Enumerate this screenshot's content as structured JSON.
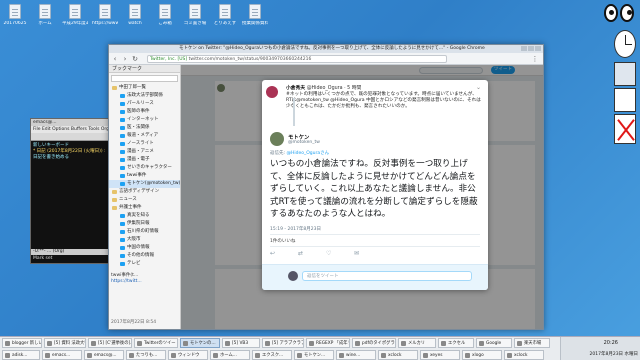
{
  "desktop": {
    "icons": [
      {
        "label": "20170625"
      },
      {
        "label": "ホーム"
      },
      {
        "label": "平成29年度あばば"
      },
      {
        "label": "https://www.yo..."
      },
      {
        "label": "watch"
      },
      {
        "label": "ごみ箱"
      },
      {
        "label": "ゴミ置き場"
      },
      {
        "label": "とりあえず"
      },
      {
        "label": "授業関係資料"
      }
    ]
  },
  "emacs": {
    "title": "emacs@...",
    "menu": "File Edit Options Buffers Tools Org Tbl",
    "line1": "新しいキーボード",
    "line2": "* 日記 (2017年8月22日 (火曜日)) :",
    "line3": "日記を書き始める",
    "modeline": "-U:**- ... (Org)",
    "echo": "Mark set"
  },
  "browser": {
    "title": "モトケン on Twitter: \"@Hideo_Oguraいつもの小倉論法ですね。反対事例を一つ取り上げて、全体に反論したように見せかけて…\" - Google Chrome",
    "url_secure": "Twitter, Inc. [US]",
    "url": "twitter.com/motoken_tw/status/900349703660244216",
    "sidebar_header": "ブックマーク",
    "bookmarks": [
      {
        "label": "中田了郎一覧",
        "folder": true
      },
      {
        "label": "法政大法学部関係",
        "folder": false
      },
      {
        "label": "パールリース",
        "folder": false
      },
      {
        "label": "医師の事件",
        "folder": false
      },
      {
        "label": "インターネット",
        "folder": false
      },
      {
        "label": "医・法関係",
        "folder": false
      },
      {
        "label": "報道・メディア",
        "folder": false
      },
      {
        "label": "ノースライト",
        "folder": false
      },
      {
        "label": "漫画・アニメ",
        "folder": false
      },
      {
        "label": "漫画・電子",
        "folder": false
      },
      {
        "label": "せいきのキャラクター",
        "folder": false
      },
      {
        "label": "twwi事件",
        "folder": false
      },
      {
        "label": "モトケン(@motoken_tw)",
        "folder": false
      },
      {
        "label": "言語ボディデザイン",
        "folder": true
      },
      {
        "label": "ニュース",
        "folder": true
      },
      {
        "label": "弁護士事件",
        "folder": true
      },
      {
        "label": "真実を知る",
        "folder": false
      },
      {
        "label": "伊集院日報",
        "folder": false
      },
      {
        "label": "石川県の町情報",
        "folder": false
      },
      {
        "label": "大阪市",
        "folder": false
      },
      {
        "label": "中国の情報",
        "folder": false
      },
      {
        "label": "その他の情報",
        "folder": false
      },
      {
        "label": "テレビ",
        "folder": false
      }
    ],
    "sidebar_preview_title": "twwi事件(t...",
    "sidebar_preview_link": "https://twitt...",
    "sidebar_date": "2017年8月22日 8:54",
    "tweet_button": "ツイート"
  },
  "tweet": {
    "orig_name": "小倉秀夫",
    "orig_handle": "@Hideo_Ogura",
    "orig_time": "· 5 時間",
    "orig_text": "#ネットの利用はいくつかの点で、既の犯罪対象となっています。時点に届いていませんが、RTは@motoken_tw @Hideo_Ogura 中国とかロシアなどの発言制限は昔いないのに、それは少なくともこれは、たかだか批判も、発言されたいいのか。",
    "author_name": "モトケン",
    "author_handle": "@motoken_tw",
    "reply_to_prefix": "返信先:",
    "reply_to_handle": "@Hideo_Oguraさん",
    "main_text": "いつもの小倉論法ですね。反対事例を一つ取り上げて、全体に反論したように見せかけてどんどん論点をずらしていく。これ以上あなたと議論しません。非公式RTを使って議論の流れを分断して論定ずらしを隠蔽するあなたのような人とはね。",
    "timestamp": "15:19 - 2017年8月23日",
    "favs": "1件のいいね",
    "reply_placeholder": "返信をツイート"
  },
  "taskbar": {
    "row1": [
      {
        "label": "blogger 新しい投稿"
      },
      {
        "label": "[5] 資料 法政大学..."
      },
      {
        "label": "[5] [C'選挙後の]..."
      },
      {
        "label": "Twitterのツイート"
      },
      {
        "label": "モトケンの…"
      },
      {
        "label": "[5] VB3"
      },
      {
        "label": "[5] アラブクラブ"
      },
      {
        "label": "REGEXP 「成年うず」"
      },
      {
        "label": "pdfのタイポグラフィ"
      },
      {
        "label": "メルカリ"
      },
      {
        "label": "エクセル"
      },
      {
        "label": "Google"
      },
      {
        "label": "楽天市場"
      }
    ],
    "row2": [
      {
        "label": "adisk..."
      },
      {
        "label": "emacs..."
      },
      {
        "label": "emacs@..."
      },
      {
        "label": "たつりも..."
      },
      {
        "label": "ウィンドウ"
      },
      {
        "label": "ホーム..."
      },
      {
        "label": "エクスク..."
      },
      {
        "label": "モトケン..."
      },
      {
        "label": "wine..."
      },
      {
        "label": "xclock"
      },
      {
        "label": "xeyes"
      },
      {
        "label": "xlogo"
      },
      {
        "label": "xclock"
      }
    ],
    "time": "20:26",
    "date": "2017年8月23日 水曜日"
  }
}
